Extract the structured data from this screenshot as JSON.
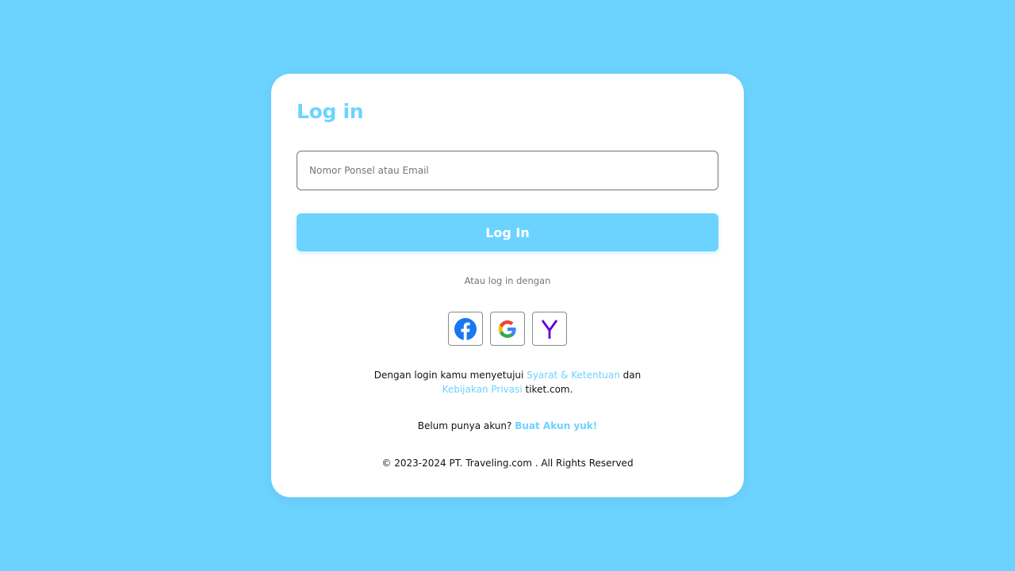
{
  "login": {
    "title": "Log in",
    "identifier_placeholder": "Nomor Ponsel atau Email",
    "identifier_value": "",
    "submit_label": "Log In",
    "divider_text": "Atau log in dengan"
  },
  "social": [
    {
      "name": "Facebook",
      "icon": "facebook-icon",
      "color": "#1877f2"
    },
    {
      "name": "Google",
      "icon": "google-icon",
      "color": "#4285f4"
    },
    {
      "name": "Yahoo",
      "icon": "yahoo-icon",
      "color": "#6001d2"
    }
  ],
  "terms": {
    "prefix": "Dengan login kamu menyetujui ",
    "terms_link": "Syarat & Ketentuan",
    "middle": " dan",
    "privacy_link": "Kebijakan Privasi",
    "suffix": " tiket.com."
  },
  "signup": {
    "prompt": "Belum punya akun? ",
    "link": "Buat Akun yuk!"
  },
  "footer": {
    "copyright": "© 2023-2024 PT. Traveling.com . All Rights Reserved"
  },
  "colors": {
    "background": "#6cd3ff",
    "accent": "#6cd3ff",
    "card": "#ffffff"
  }
}
